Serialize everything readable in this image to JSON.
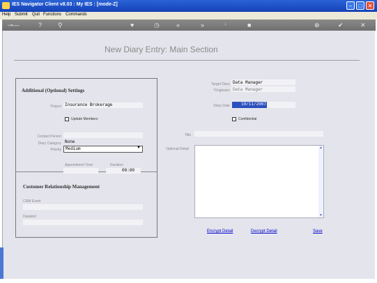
{
  "window": {
    "title": "IES Navigator Client v8.03 : My IES :   [mode-Z]"
  },
  "menubar": [
    "Help",
    "Submit",
    "Quit",
    "Functions",
    "Commands"
  ],
  "toolbar_icons": [
    "key-icon",
    "help-icon",
    "search-icon",
    "heart-icon",
    "history-icon",
    "rewind-icon",
    "forward-icon",
    "info-icon",
    "stop-icon",
    "globe-icon",
    "ok-icon",
    "close-icon"
  ],
  "page": {
    "title": "New Diary Entry: Main Section"
  },
  "settings": {
    "heading": "Additional (Optional) Settings",
    "project_label": "Project",
    "project_value": "Insurance Brokerage",
    "update_members_label": "Update Members",
    "contact_person_label": "Contact Person",
    "diary_category_label": "Diary Category",
    "diary_category_value": "None",
    "priority_label": "Priority",
    "priority_value": "Medium",
    "appointment_time_label": "Appointment Time",
    "duration_label": "Duration",
    "duration_value": "00:00"
  },
  "crm": {
    "heading": "Customer Relationship Management",
    "crm_event_label": "CRM Event",
    "databkrt_label": "Databkrt"
  },
  "entry": {
    "target_diary_label": "Target Diary",
    "target_diary_value": "Data Manager",
    "originator_label": "*Originator",
    "originator_value": "Data Manager",
    "diary_date_label": "Diary Date",
    "diary_date_value": "19/11/2007",
    "confidential_label": "Confidential",
    "title_label": "Title",
    "optional_detail_label": "Optional Detail"
  },
  "actions": {
    "encrypt": "Encrypt Detail",
    "decrypt": "Decrypt Detail",
    "save": "Save"
  },
  "colors": {
    "titlebar": "#1f55cc",
    "link": "#0000cc",
    "date_highlight": "#2b4fbd"
  }
}
